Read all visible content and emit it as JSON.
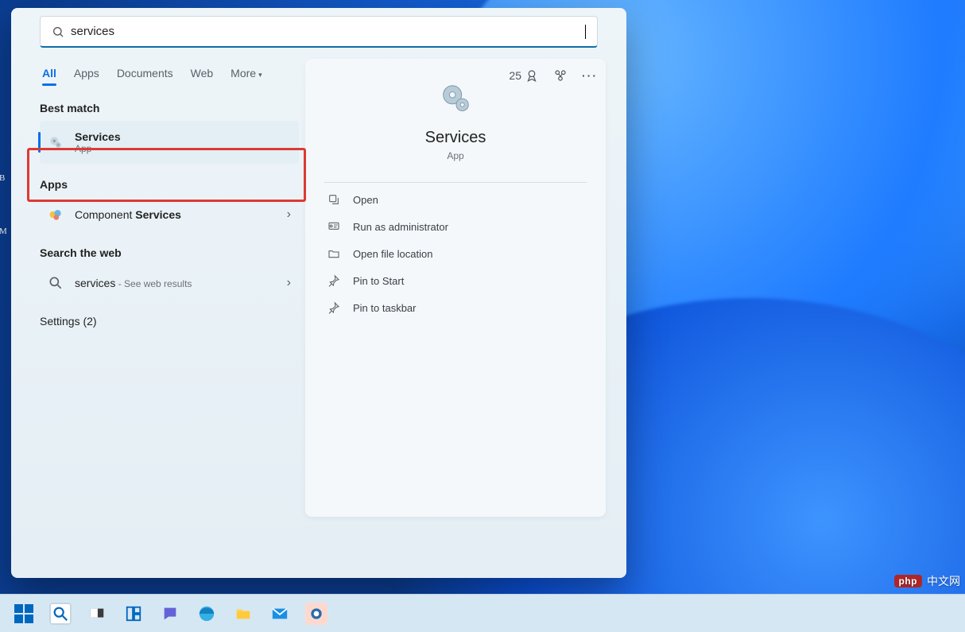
{
  "desktop": {
    "label_b": "B",
    "label_m": "M"
  },
  "search": {
    "query": "services",
    "tabs": {
      "all": "All",
      "apps": "Apps",
      "documents": "Documents",
      "web": "Web",
      "more": "More"
    },
    "points_count": "25"
  },
  "sections": {
    "best_match": "Best match",
    "apps": "Apps",
    "search_web": "Search the web",
    "settings": "Settings (2)"
  },
  "best_match_item": {
    "title": "Services",
    "subtitle": "App"
  },
  "apps_item": {
    "prefix": "Component ",
    "bold": "Services"
  },
  "web_item": {
    "term": "services",
    "suffix": " - See web results"
  },
  "detail": {
    "title": "Services",
    "subtitle": "App"
  },
  "actions": {
    "open": "Open",
    "run_admin": "Run as administrator",
    "open_loc": "Open file location",
    "pin_start": "Pin to Start",
    "pin_taskbar": "Pin to taskbar"
  },
  "watermark": {
    "badge": "php",
    "text": "中文网"
  }
}
